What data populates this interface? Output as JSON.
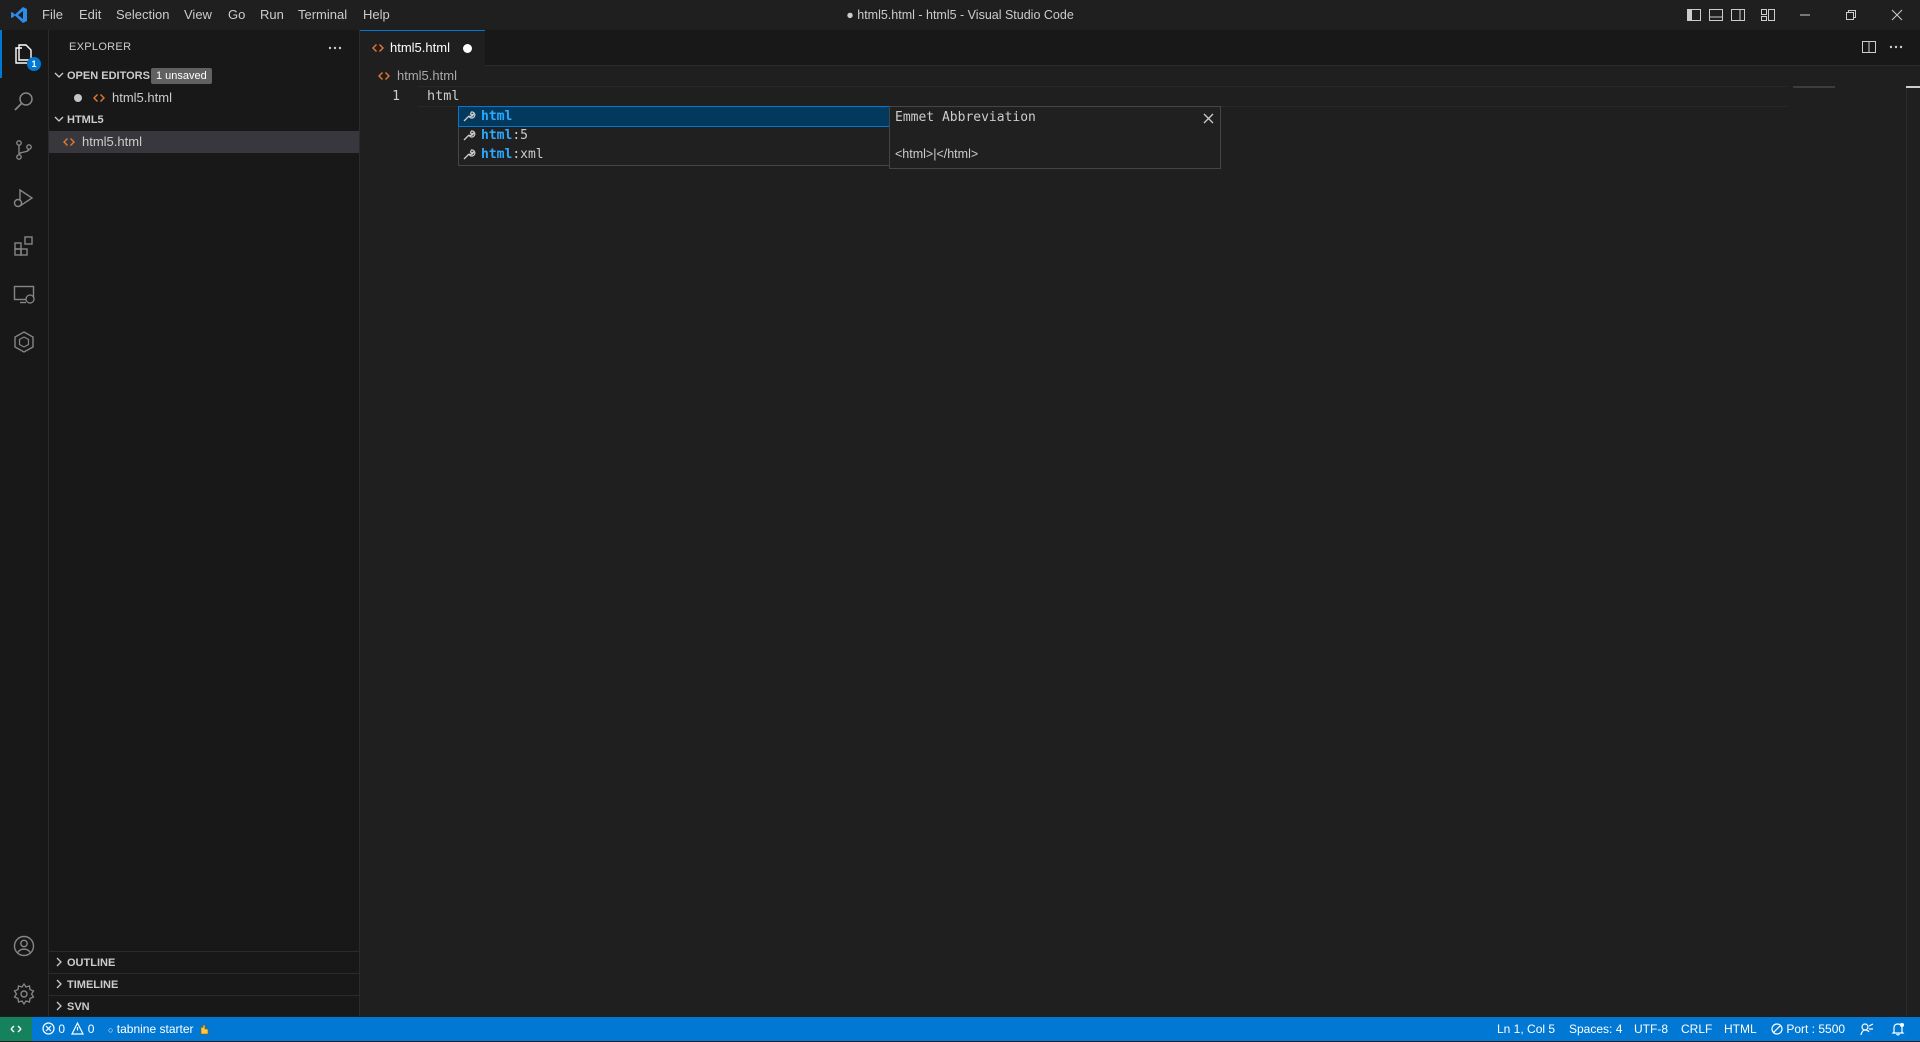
{
  "menu": [
    "File",
    "Edit",
    "Selection",
    "View",
    "Go",
    "Run",
    "Terminal",
    "Help"
  ],
  "window_title": "● html5.html - html5 - Visual Studio Code",
  "activity_bar": {
    "explorer_badge": "1",
    "icons": [
      "explorer-icon",
      "search-icon",
      "source-control-icon",
      "run-debug-icon",
      "extensions-icon",
      "remote-explorer-icon",
      "tabnine-icon",
      "account-icon",
      "settings-gear-icon"
    ]
  },
  "sidebar": {
    "title": "EXPLORER",
    "open_editors": {
      "label": "OPEN EDITORS",
      "badge": "1 unsaved",
      "items": [
        {
          "name": "html5.html",
          "dirty": true
        }
      ]
    },
    "folder": {
      "label": "HTML5",
      "items": [
        {
          "name": "html5.html",
          "selected": true
        }
      ]
    },
    "bottom_sections": [
      "OUTLINE",
      "TIMELINE",
      "SVN"
    ]
  },
  "editor": {
    "tab": {
      "label": "html5.html",
      "dirty": true
    },
    "breadcrumb": "html5.html",
    "lines": [
      {
        "number": "1",
        "text": "html"
      }
    ]
  },
  "suggest": {
    "items": [
      {
        "match": "html",
        "rest": ""
      },
      {
        "match": "html",
        "rest": ":5"
      },
      {
        "match": "html",
        "rest": ":xml"
      }
    ],
    "selected_index": 0,
    "details": {
      "title": "Emmet Abbreviation",
      "body": "<html>|</html>"
    }
  },
  "status_bar": {
    "errors": "0",
    "warnings": "0",
    "tabnine": "tabnine starter",
    "position": "Ln 1, Col 5",
    "spaces": "Spaces: 4",
    "encoding": "UTF-8",
    "eol": "CRLF",
    "language": "HTML",
    "port": "Port : 5500"
  },
  "colors": {
    "accent": "#0078d4",
    "statusbar": "#0078d4",
    "remote": "#16825d",
    "html_icon": "#e37933",
    "suggest_highlight": "#2aaaff"
  }
}
